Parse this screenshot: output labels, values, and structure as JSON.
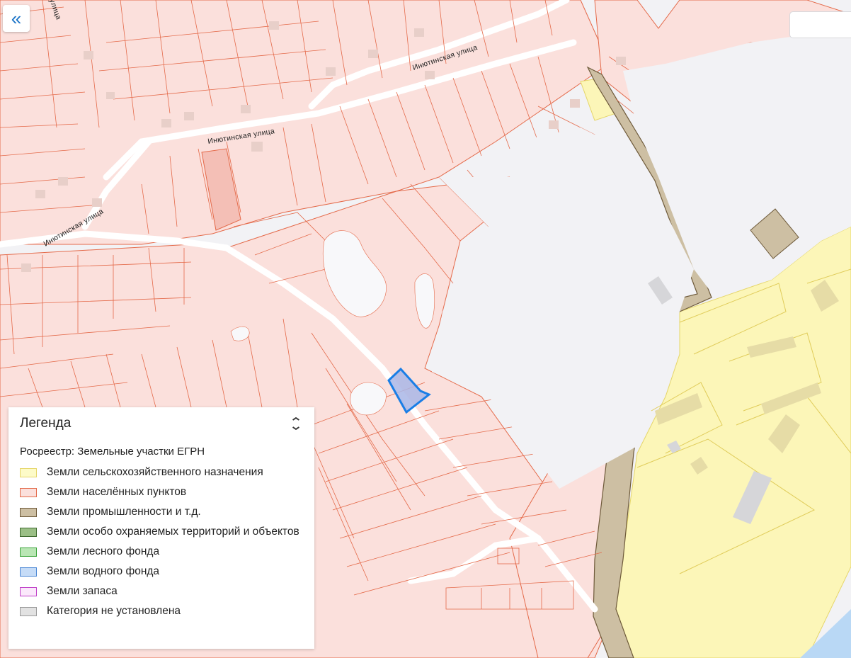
{
  "map": {
    "streets": [
      {
        "id": "street-1",
        "label": "Инютинская улица"
      },
      {
        "id": "street-2",
        "label": "Инютинская улица"
      },
      {
        "id": "street-3",
        "label": "Инютинская улица"
      },
      {
        "id": "street-4",
        "label": "улица"
      }
    ],
    "highlight_color": "#1a7ee6"
  },
  "controls": {
    "collapse_icon": "«",
    "legend_toggle_icon": "⌄⌃"
  },
  "legend": {
    "title": "Легенда",
    "subtitle": "Росреестр: Земельные участки ЕГРН",
    "items": [
      {
        "label": "Земли сельскохозяйственного назначения",
        "fill": "#fdfbc8",
        "stroke": "#e6d66a"
      },
      {
        "label": "Земли населённых пунктов",
        "fill": "#fbe0dc",
        "stroke": "#e46a4a"
      },
      {
        "label": "Земли промышленности и т.д.",
        "fill": "#cdbfa3",
        "stroke": "#6e5a3a"
      },
      {
        "label": "Земли особо охраняемых территорий и объектов",
        "fill": "#9bbf86",
        "stroke": "#3e6a2e"
      },
      {
        "label": "Земли лесного фонда",
        "fill": "#b9e6b4",
        "stroke": "#3aa43a"
      },
      {
        "label": "Земли водного фонда",
        "fill": "#c6dcf7",
        "stroke": "#4a86d4"
      },
      {
        "label": "Земли запаса",
        "fill": "#fbe8fb",
        "stroke": "#c040c8"
      },
      {
        "label": "Категория не установлена",
        "fill": "#e2e2e2",
        "stroke": "#9a9a9a"
      }
    ]
  }
}
